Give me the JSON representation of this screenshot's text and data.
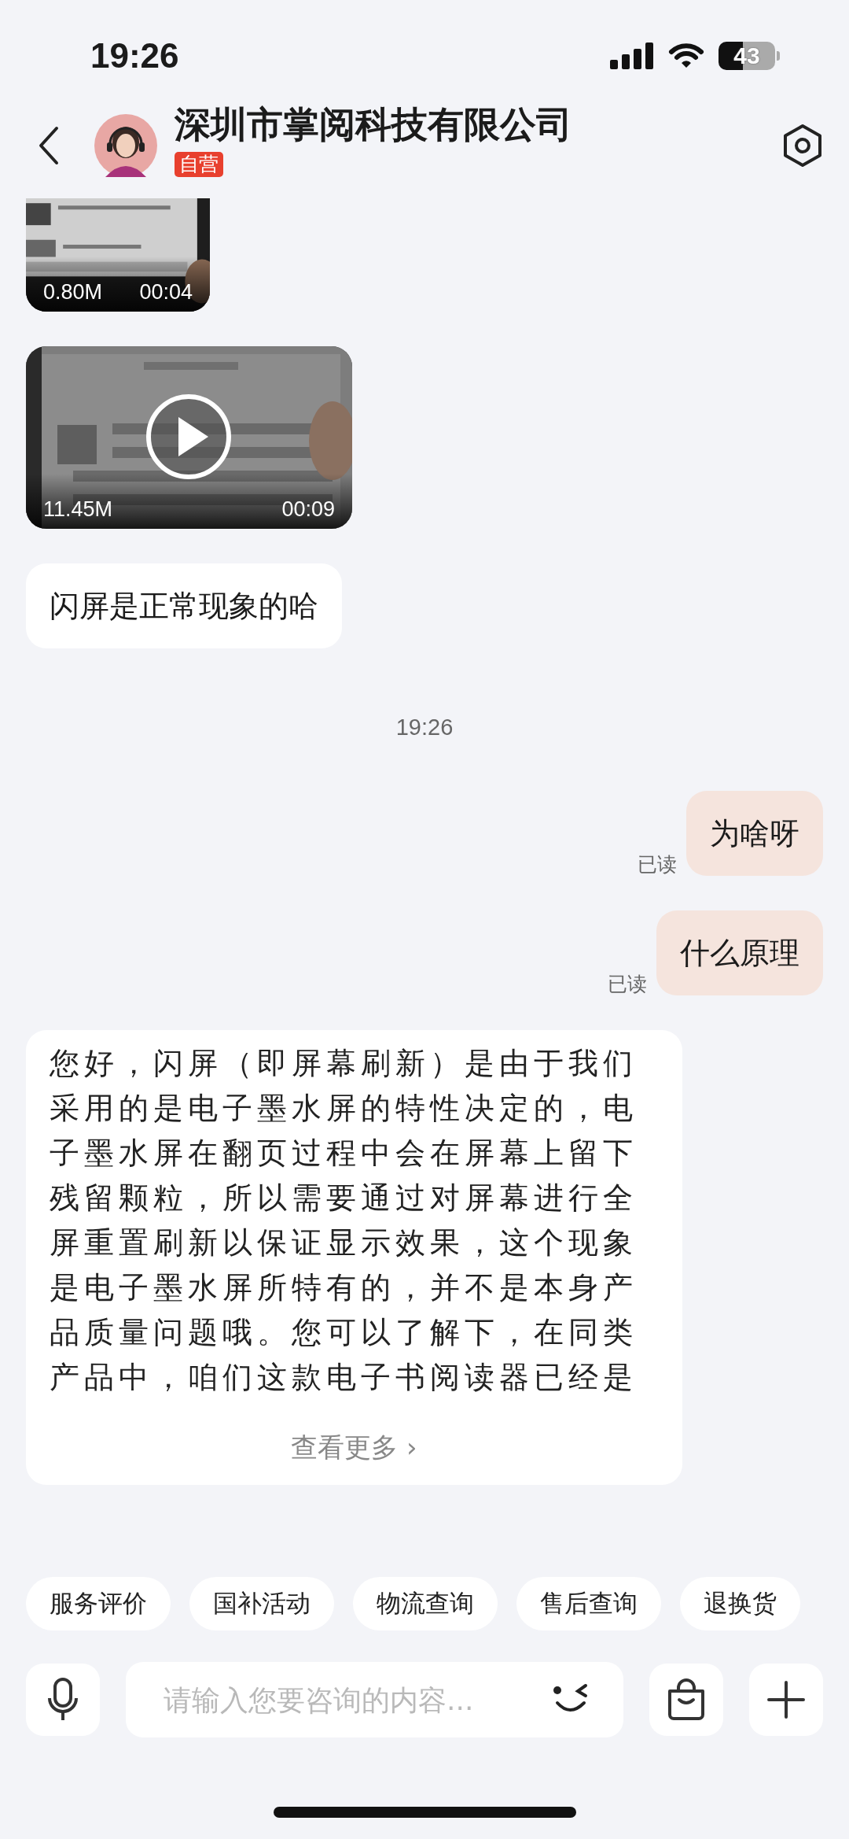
{
  "status_bar": {
    "time": "19:26",
    "battery": "43"
  },
  "header": {
    "title": "深圳市掌阅科技有限公司",
    "badge": "自营"
  },
  "messages": [
    {
      "kind": "video",
      "mine": false,
      "cut": true,
      "size": "0.80M",
      "duration": "00:04",
      "play": false
    },
    {
      "kind": "video",
      "mine": false,
      "cut": false,
      "size": "11.45M",
      "duration": "00:09",
      "play": true
    },
    {
      "kind": "text",
      "mine": false,
      "text": "闪屏是正常现象的哈"
    },
    {
      "kind": "time",
      "text": "19:26"
    },
    {
      "kind": "text",
      "mine": true,
      "text": "为啥呀",
      "receipt": "已读"
    },
    {
      "kind": "text",
      "mine": true,
      "text": "什么原理",
      "receipt": "已读"
    },
    {
      "kind": "long",
      "mine": false,
      "text": "您好，闪屏（即屏幕刷新）是由于我们采用的是电子墨水屏的特性决定的，电子墨水屏在翻页过程中会在屏幕上留下残留颗粒，所以需要通过对屏幕进行全屏重置刷新以保证显示效果，这个现象是电子墨水屏所特有的，并不是本身产品质量问题哦。您可以了解下，在同类产品中，咱们这款电子书阅读器已经是",
      "more": "查看更多 ›"
    }
  ],
  "quick_replies": [
    "服务评价",
    "国补活动",
    "物流查询",
    "售后查询",
    "退换货"
  ],
  "input": {
    "placeholder": "请输入您要咨询的内容..."
  }
}
